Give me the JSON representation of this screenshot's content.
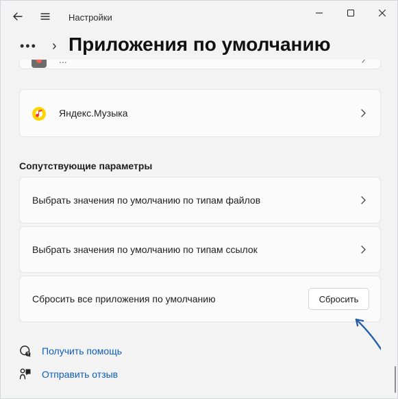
{
  "window": {
    "title": "Настройки"
  },
  "header": {
    "page_title": "Приложения по умолчанию",
    "breadcrumb_more": "•••",
    "breadcrumb_separator": "›"
  },
  "apps": {
    "partial_label": "...",
    "yandex_music_label": "Яндекс.Музыка"
  },
  "related": {
    "section_title": "Сопутствующие параметры",
    "file_types_label": "Выбрать значения по умолчанию по типам файлов",
    "link_types_label": "Выбрать значения по умолчанию по типам ссылок",
    "reset_all_label": "Сбросить все приложения по умолчанию",
    "reset_button_label": "Сбросить"
  },
  "footer": {
    "help_label": "Получить помощь",
    "feedback_label": "Отправить отзыв"
  },
  "colors": {
    "accent_link": "#0d5db8",
    "annotation_arrow": "#245ea8",
    "yandex_yellow": "#ffd400",
    "yandex_red": "#ff3b30"
  },
  "icons": {
    "back": "back-arrow-icon",
    "menu": "hamburger-menu-icon",
    "minimize": "minimize-icon",
    "maximize": "maximize-icon",
    "close": "close-icon",
    "chevron": "chevron-right-icon",
    "help": "help-icon",
    "feedback": "feedback-icon",
    "music": "yandex-music-icon"
  }
}
